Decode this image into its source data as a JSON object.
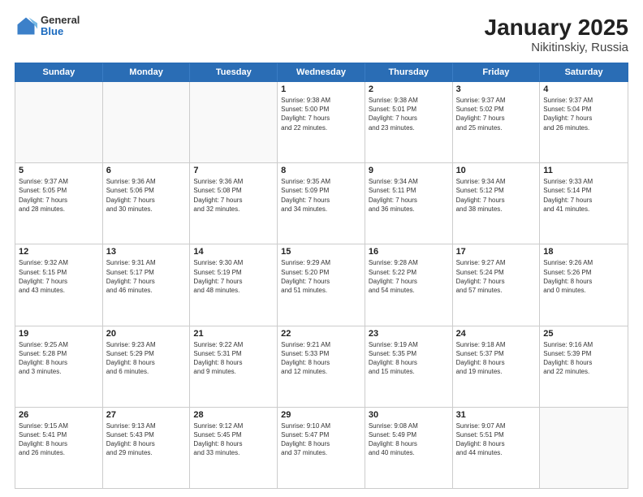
{
  "logo": {
    "general": "General",
    "blue": "Blue"
  },
  "title": "January 2025",
  "subtitle": "Nikitinskiy, Russia",
  "weekdays": [
    "Sunday",
    "Monday",
    "Tuesday",
    "Wednesday",
    "Thursday",
    "Friday",
    "Saturday"
  ],
  "rows": [
    [
      {
        "day": "",
        "info": ""
      },
      {
        "day": "",
        "info": ""
      },
      {
        "day": "",
        "info": ""
      },
      {
        "day": "1",
        "info": "Sunrise: 9:38 AM\nSunset: 5:00 PM\nDaylight: 7 hours\nand 22 minutes."
      },
      {
        "day": "2",
        "info": "Sunrise: 9:38 AM\nSunset: 5:01 PM\nDaylight: 7 hours\nand 23 minutes."
      },
      {
        "day": "3",
        "info": "Sunrise: 9:37 AM\nSunset: 5:02 PM\nDaylight: 7 hours\nand 25 minutes."
      },
      {
        "day": "4",
        "info": "Sunrise: 9:37 AM\nSunset: 5:04 PM\nDaylight: 7 hours\nand 26 minutes."
      }
    ],
    [
      {
        "day": "5",
        "info": "Sunrise: 9:37 AM\nSunset: 5:05 PM\nDaylight: 7 hours\nand 28 minutes."
      },
      {
        "day": "6",
        "info": "Sunrise: 9:36 AM\nSunset: 5:06 PM\nDaylight: 7 hours\nand 30 minutes."
      },
      {
        "day": "7",
        "info": "Sunrise: 9:36 AM\nSunset: 5:08 PM\nDaylight: 7 hours\nand 32 minutes."
      },
      {
        "day": "8",
        "info": "Sunrise: 9:35 AM\nSunset: 5:09 PM\nDaylight: 7 hours\nand 34 minutes."
      },
      {
        "day": "9",
        "info": "Sunrise: 9:34 AM\nSunset: 5:11 PM\nDaylight: 7 hours\nand 36 minutes."
      },
      {
        "day": "10",
        "info": "Sunrise: 9:34 AM\nSunset: 5:12 PM\nDaylight: 7 hours\nand 38 minutes."
      },
      {
        "day": "11",
        "info": "Sunrise: 9:33 AM\nSunset: 5:14 PM\nDaylight: 7 hours\nand 41 minutes."
      }
    ],
    [
      {
        "day": "12",
        "info": "Sunrise: 9:32 AM\nSunset: 5:15 PM\nDaylight: 7 hours\nand 43 minutes."
      },
      {
        "day": "13",
        "info": "Sunrise: 9:31 AM\nSunset: 5:17 PM\nDaylight: 7 hours\nand 46 minutes."
      },
      {
        "day": "14",
        "info": "Sunrise: 9:30 AM\nSunset: 5:19 PM\nDaylight: 7 hours\nand 48 minutes."
      },
      {
        "day": "15",
        "info": "Sunrise: 9:29 AM\nSunset: 5:20 PM\nDaylight: 7 hours\nand 51 minutes."
      },
      {
        "day": "16",
        "info": "Sunrise: 9:28 AM\nSunset: 5:22 PM\nDaylight: 7 hours\nand 54 minutes."
      },
      {
        "day": "17",
        "info": "Sunrise: 9:27 AM\nSunset: 5:24 PM\nDaylight: 7 hours\nand 57 minutes."
      },
      {
        "day": "18",
        "info": "Sunrise: 9:26 AM\nSunset: 5:26 PM\nDaylight: 8 hours\nand 0 minutes."
      }
    ],
    [
      {
        "day": "19",
        "info": "Sunrise: 9:25 AM\nSunset: 5:28 PM\nDaylight: 8 hours\nand 3 minutes."
      },
      {
        "day": "20",
        "info": "Sunrise: 9:23 AM\nSunset: 5:29 PM\nDaylight: 8 hours\nand 6 minutes."
      },
      {
        "day": "21",
        "info": "Sunrise: 9:22 AM\nSunset: 5:31 PM\nDaylight: 8 hours\nand 9 minutes."
      },
      {
        "day": "22",
        "info": "Sunrise: 9:21 AM\nSunset: 5:33 PM\nDaylight: 8 hours\nand 12 minutes."
      },
      {
        "day": "23",
        "info": "Sunrise: 9:19 AM\nSunset: 5:35 PM\nDaylight: 8 hours\nand 15 minutes."
      },
      {
        "day": "24",
        "info": "Sunrise: 9:18 AM\nSunset: 5:37 PM\nDaylight: 8 hours\nand 19 minutes."
      },
      {
        "day": "25",
        "info": "Sunrise: 9:16 AM\nSunset: 5:39 PM\nDaylight: 8 hours\nand 22 minutes."
      }
    ],
    [
      {
        "day": "26",
        "info": "Sunrise: 9:15 AM\nSunset: 5:41 PM\nDaylight: 8 hours\nand 26 minutes."
      },
      {
        "day": "27",
        "info": "Sunrise: 9:13 AM\nSunset: 5:43 PM\nDaylight: 8 hours\nand 29 minutes."
      },
      {
        "day": "28",
        "info": "Sunrise: 9:12 AM\nSunset: 5:45 PM\nDaylight: 8 hours\nand 33 minutes."
      },
      {
        "day": "29",
        "info": "Sunrise: 9:10 AM\nSunset: 5:47 PM\nDaylight: 8 hours\nand 37 minutes."
      },
      {
        "day": "30",
        "info": "Sunrise: 9:08 AM\nSunset: 5:49 PM\nDaylight: 8 hours\nand 40 minutes."
      },
      {
        "day": "31",
        "info": "Sunrise: 9:07 AM\nSunset: 5:51 PM\nDaylight: 8 hours\nand 44 minutes."
      },
      {
        "day": "",
        "info": ""
      }
    ]
  ]
}
